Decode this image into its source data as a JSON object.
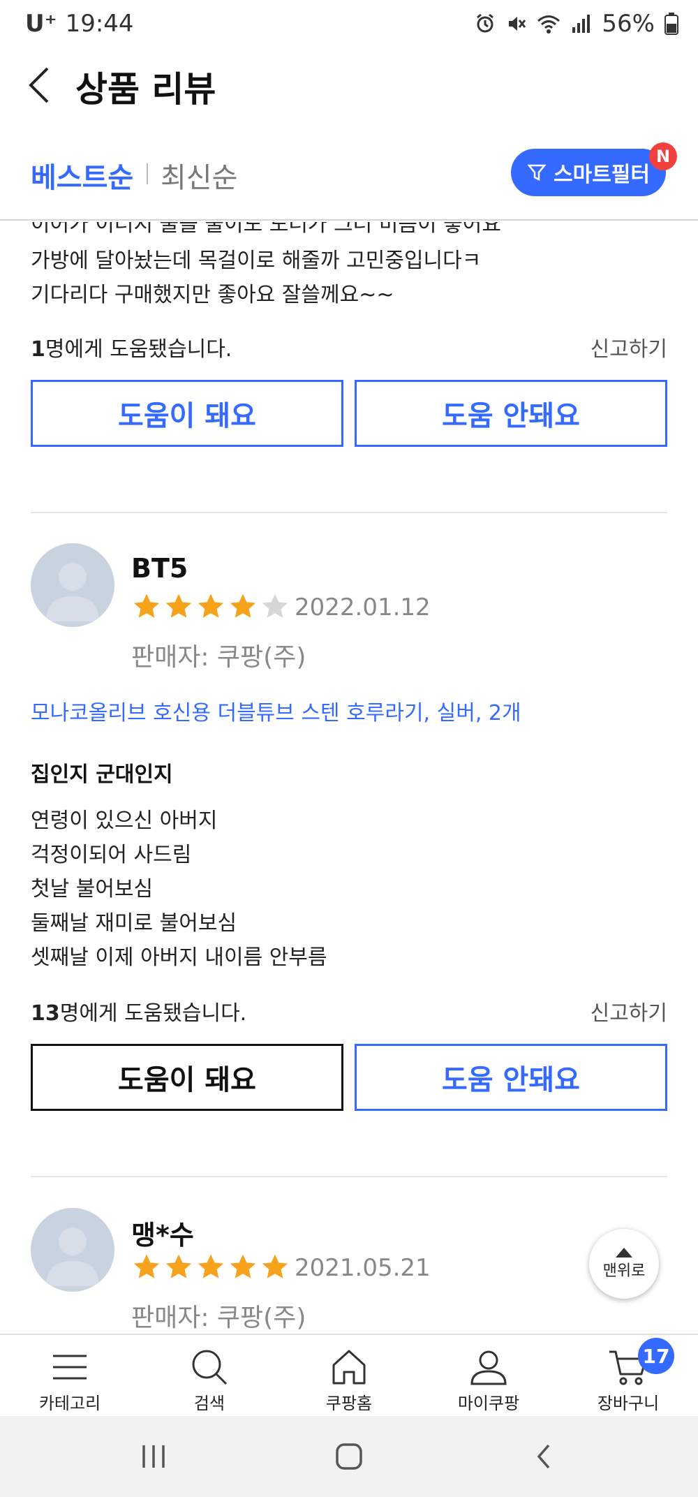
{
  "status_bar": {
    "carrier": "U⁺",
    "time": "19:44",
    "battery": "56%"
  },
  "header": {
    "title": "상품 리뷰"
  },
  "sort": {
    "best": "베스트순",
    "newest": "최신순",
    "smart_filter": "스마트필터",
    "new_badge": "N"
  },
  "review1": {
    "cut_line": "이어가 이더지 물을 물이도 도더가 그더 미듬이 좋어요",
    "lines": [
      "가방에 달아놨는데 목걸이로 해줄까 고민중입니다ㅋ",
      "기다리다 구매했지만 좋아요 잘쓸께요~~"
    ],
    "helped_count": "1",
    "helped_suffix": "명에게 도움됐습니다.",
    "report": "신고하기",
    "helpful": "도움이 돼요",
    "not_helpful": "도움 안돼요"
  },
  "review2": {
    "name": "BT5",
    "rating": 4,
    "date": "2022.01.12",
    "seller": "판매자: 쿠팡(주)",
    "product": "모나코올리브 호신용 더블튜브 스텐 호루라기, 실버, 2개",
    "headline": "집인지 군대인지",
    "lines": [
      "연령이 있으신 아버지",
      "걱정이되어 사드림",
      "첫날 불어보심",
      "둘째날 재미로 불어보심",
      "셋째날 이제 아버지 내이름 안부름"
    ],
    "helped_count": "13",
    "helped_suffix": "명에게 도움됐습니다.",
    "report": "신고하기",
    "helpful": "도움이 돼요",
    "not_helpful": "도움 안돼요"
  },
  "review3": {
    "name": "맹*수",
    "rating": 5,
    "date": "2021.05.21",
    "seller": "판매자: 쿠팡(주)"
  },
  "to_top": "맨위로",
  "bottom_nav": {
    "category": "카테고리",
    "search": "검색",
    "home": "쿠팡홈",
    "my": "마이쿠팡",
    "cart": "장바구니",
    "cart_count": "17"
  },
  "colors": {
    "accent": "#346aff",
    "star": "#f7a21b",
    "badge_red": "#f0413f"
  }
}
